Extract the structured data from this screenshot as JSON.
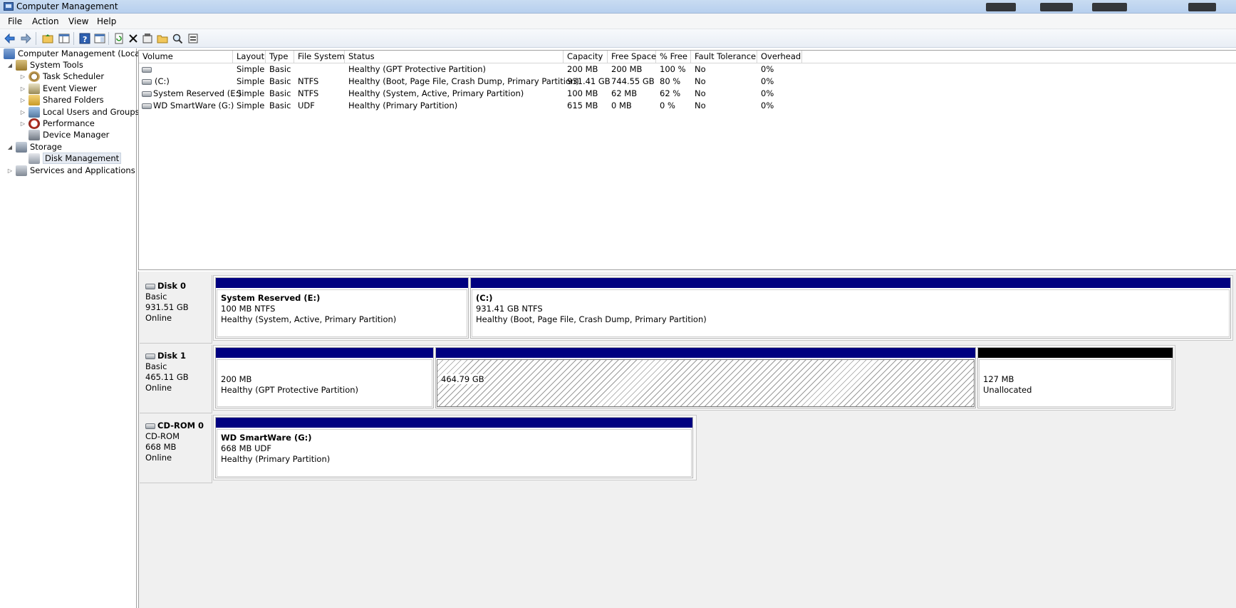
{
  "window": {
    "title": "Computer Management"
  },
  "menu": [
    "File",
    "Action",
    "View",
    "Help"
  ],
  "toolbar": {
    "icons": [
      "back-arrow-icon",
      "forward-arrow-icon",
      "up-folder-icon",
      "show-hide-tree-icon",
      "help-icon",
      "properties-pane-icon",
      "refresh-icon",
      "delete-icon",
      "properties-icon",
      "open-icon",
      "search-icon",
      "rescan-icon"
    ]
  },
  "tree": {
    "root": "Computer Management (Local",
    "system_tools": "System Tools",
    "task_scheduler": "Task Scheduler",
    "event_viewer": "Event Viewer",
    "shared_folders": "Shared Folders",
    "local_users": "Local Users and Groups",
    "performance": "Performance",
    "device_manager": "Device Manager",
    "storage": "Storage",
    "disk_management": "Disk Management",
    "services": "Services and Applications"
  },
  "volumes": {
    "columns": [
      "Volume",
      "Layout",
      "Type",
      "File System",
      "Status",
      "Capacity",
      "Free Space",
      "% Free",
      "Fault Tolerance",
      "Overhead"
    ],
    "rows": [
      {
        "volume": "",
        "layout": "Simple",
        "type": "Basic",
        "fs": "",
        "status": "Healthy (GPT Protective Partition)",
        "capacity": "200 MB",
        "free": "200 MB",
        "pct": "100 %",
        "fault": "No",
        "overhead": "0%"
      },
      {
        "volume": "(C:)",
        "layout": "Simple",
        "type": "Basic",
        "fs": "NTFS",
        "status": "Healthy (Boot, Page File, Crash Dump, Primary Partition)",
        "capacity": "931.41 GB",
        "free": "744.55 GB",
        "pct": "80 %",
        "fault": "No",
        "overhead": "0%"
      },
      {
        "volume": "System Reserved (E:)",
        "layout": "Simple",
        "type": "Basic",
        "fs": "NTFS",
        "status": "Healthy (System, Active, Primary Partition)",
        "capacity": "100 MB",
        "free": "62 MB",
        "pct": "62 %",
        "fault": "No",
        "overhead": "0%"
      },
      {
        "volume": "WD SmartWare (G:)",
        "layout": "Simple",
        "type": "Basic",
        "fs": "UDF",
        "status": "Healthy (Primary Partition)",
        "capacity": "615 MB",
        "free": "0 MB",
        "pct": "0 %",
        "fault": "No",
        "overhead": "0%"
      }
    ]
  },
  "disks": [
    {
      "name": "Disk 0",
      "type": "Basic",
      "size": "931.51 GB",
      "status": "Online",
      "partitions": [
        {
          "title": "System Reserved  (E:)",
          "size": "100 MB NTFS",
          "status": "Healthy (System, Active, Primary Partition)"
        },
        {
          "title": "  (C:)",
          "size": "931.41 GB NTFS",
          "status": "Healthy (Boot, Page File, Crash Dump, Primary Partition)"
        }
      ]
    },
    {
      "name": "Disk 1",
      "type": "Basic",
      "size": "465.11 GB",
      "status": "Online",
      "partitions": [
        {
          "size": "200 MB",
          "status": "Healthy (GPT Protective Partition)"
        },
        {
          "size": "464.79 GB"
        },
        {
          "size": "127 MB",
          "status": "Unallocated"
        }
      ]
    },
    {
      "name": "CD-ROM 0",
      "type": "CD-ROM",
      "size": "668 MB",
      "status": "Online",
      "partitions": [
        {
          "title": "WD SmartWare  (G:)",
          "size": "668 MB UDF",
          "status": "Healthy (Primary Partition)"
        }
      ]
    }
  ],
  "colors": {
    "primary_partition": "#000080",
    "unallocated": "#000000"
  }
}
